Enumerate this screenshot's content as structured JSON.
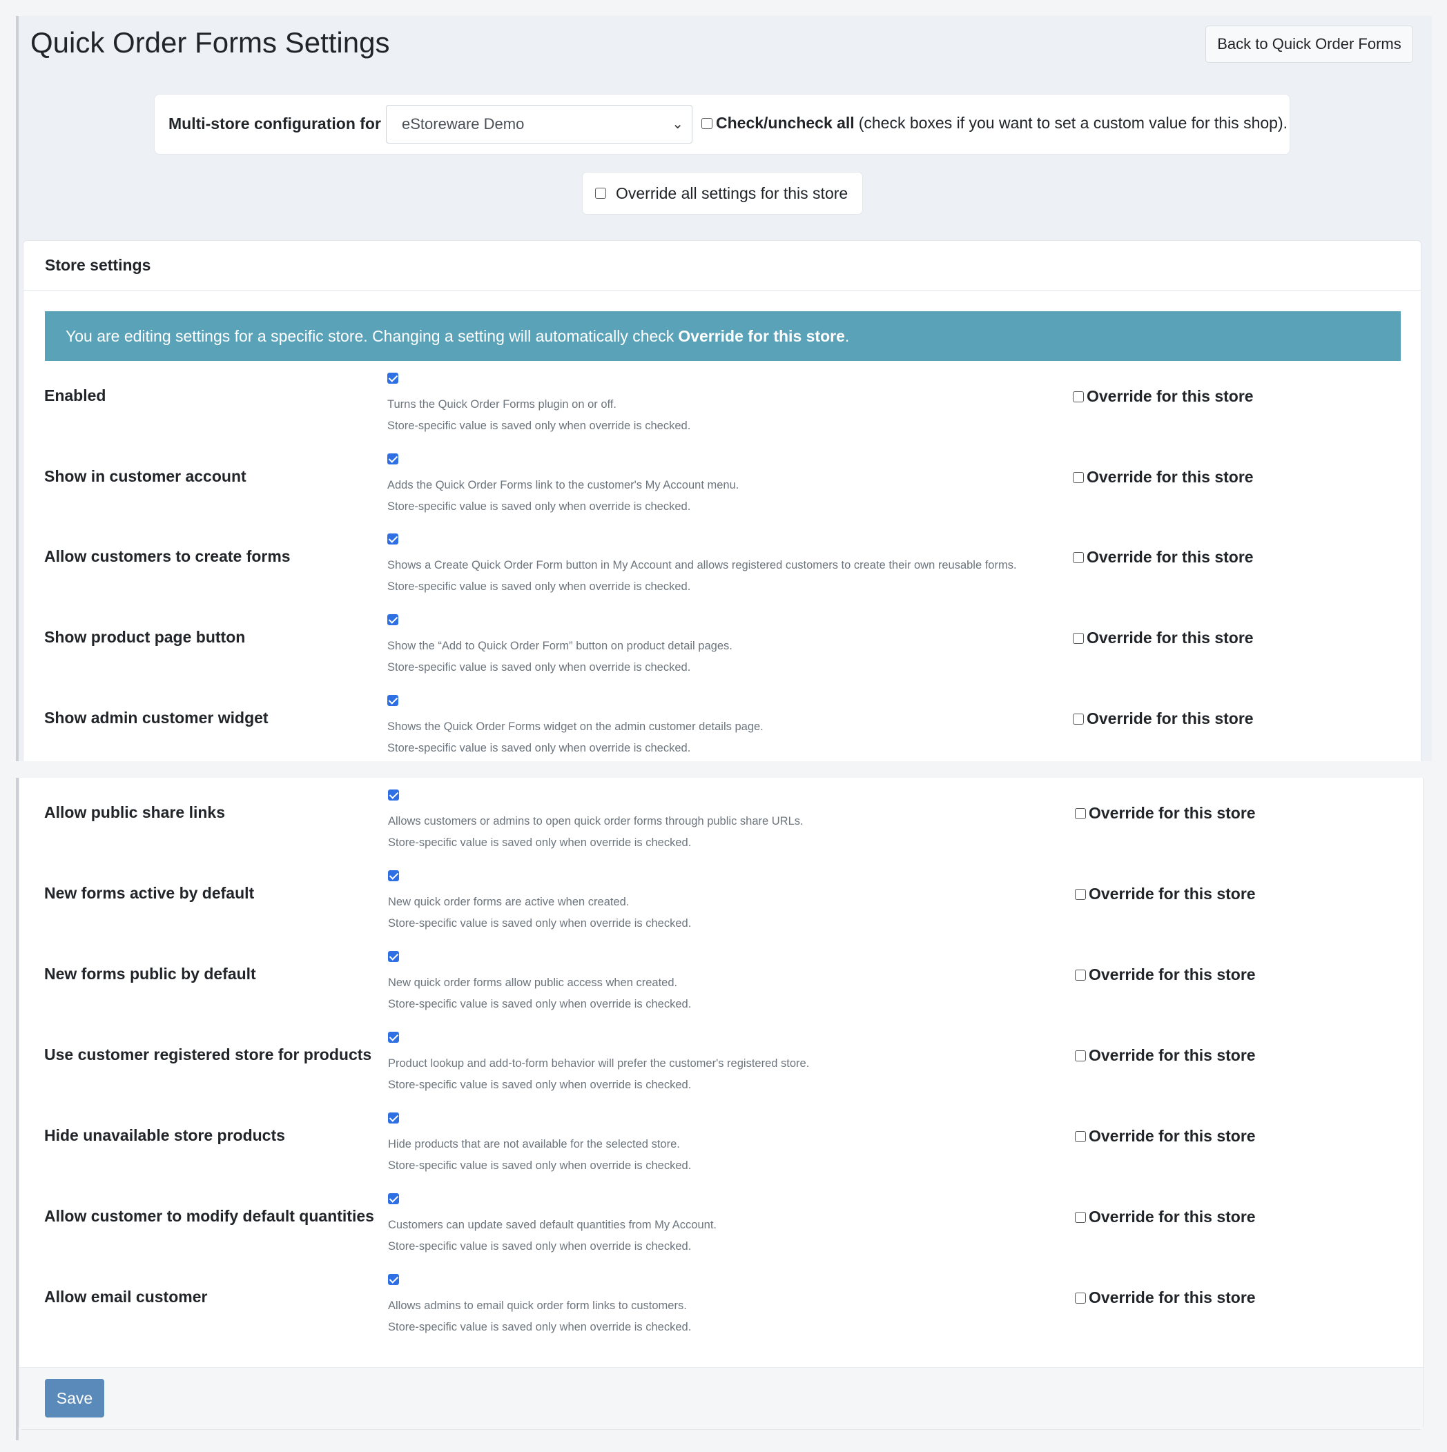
{
  "page": {
    "title": "Quick Order Forms Settings",
    "back_button": "Back to Quick Order Forms"
  },
  "multistore": {
    "label": "Multi-store configuration for",
    "selected_store": "eStoreware Demo",
    "check_all_bold": "Check/uncheck all",
    "check_all_note": "(check boxes if you want to set a custom value for this shop).",
    "override_all_label": "Override all settings for this store"
  },
  "card": {
    "header": "Store settings",
    "info_text": "You are editing settings for a specific store. Changing a setting will automatically check",
    "info_bold": "Override for this store",
    "info_end": "."
  },
  "override_label": "Override for this store",
  "store_note": "Store-specific value is saved only when override is checked.",
  "settings": [
    {
      "label": "Enabled",
      "help": "Turns the Quick Order Forms plugin on or off.",
      "checked": true,
      "override": false
    },
    {
      "label": "Show in customer account",
      "help": "Adds the Quick Order Forms link to the customer's My Account menu.",
      "checked": true,
      "override": false
    },
    {
      "label": "Allow customers to create forms",
      "help": "Shows a Create Quick Order Form button in My Account and allows registered customers to create their own reusable forms.",
      "checked": true,
      "override": false
    },
    {
      "label": "Show product page button",
      "help": "Show the “Add to Quick Order Form” button on product detail pages.",
      "checked": true,
      "override": false
    },
    {
      "label": "Show admin customer widget",
      "help": "Shows the Quick Order Forms widget on the admin customer details page.",
      "checked": true,
      "override": false
    },
    {
      "label": "Allow public share links",
      "help": "Allows customers or admins to open quick order forms through public share URLs.",
      "checked": true,
      "override": false
    },
    {
      "label": "New forms active by default",
      "help": "New quick order forms are active when created.",
      "checked": true,
      "override": false
    },
    {
      "label": "New forms public by default",
      "help": "New quick order forms allow public access when created.",
      "checked": true,
      "override": false
    },
    {
      "label": "Use customer registered store for products",
      "help": "Product lookup and add-to-form behavior will prefer the customer's registered store.",
      "checked": true,
      "override": false
    },
    {
      "label": "Hide unavailable store products",
      "help": "Hide products that are not available for the selected store.",
      "checked": true,
      "override": false
    },
    {
      "label": "Allow customer to modify default quantities",
      "help": "Customers can update saved default quantities from My Account.",
      "checked": true,
      "override": false
    },
    {
      "label": "Allow email customer",
      "help": "Allows admins to email quick order form links to customers.",
      "checked": true,
      "override": false
    }
  ],
  "footer": {
    "save_label": "Save"
  },
  "colors": {
    "info_bar": "#5aa2b7",
    "save_button": "#5a8ab9",
    "checkbox_checked": "#2f6fe4"
  }
}
